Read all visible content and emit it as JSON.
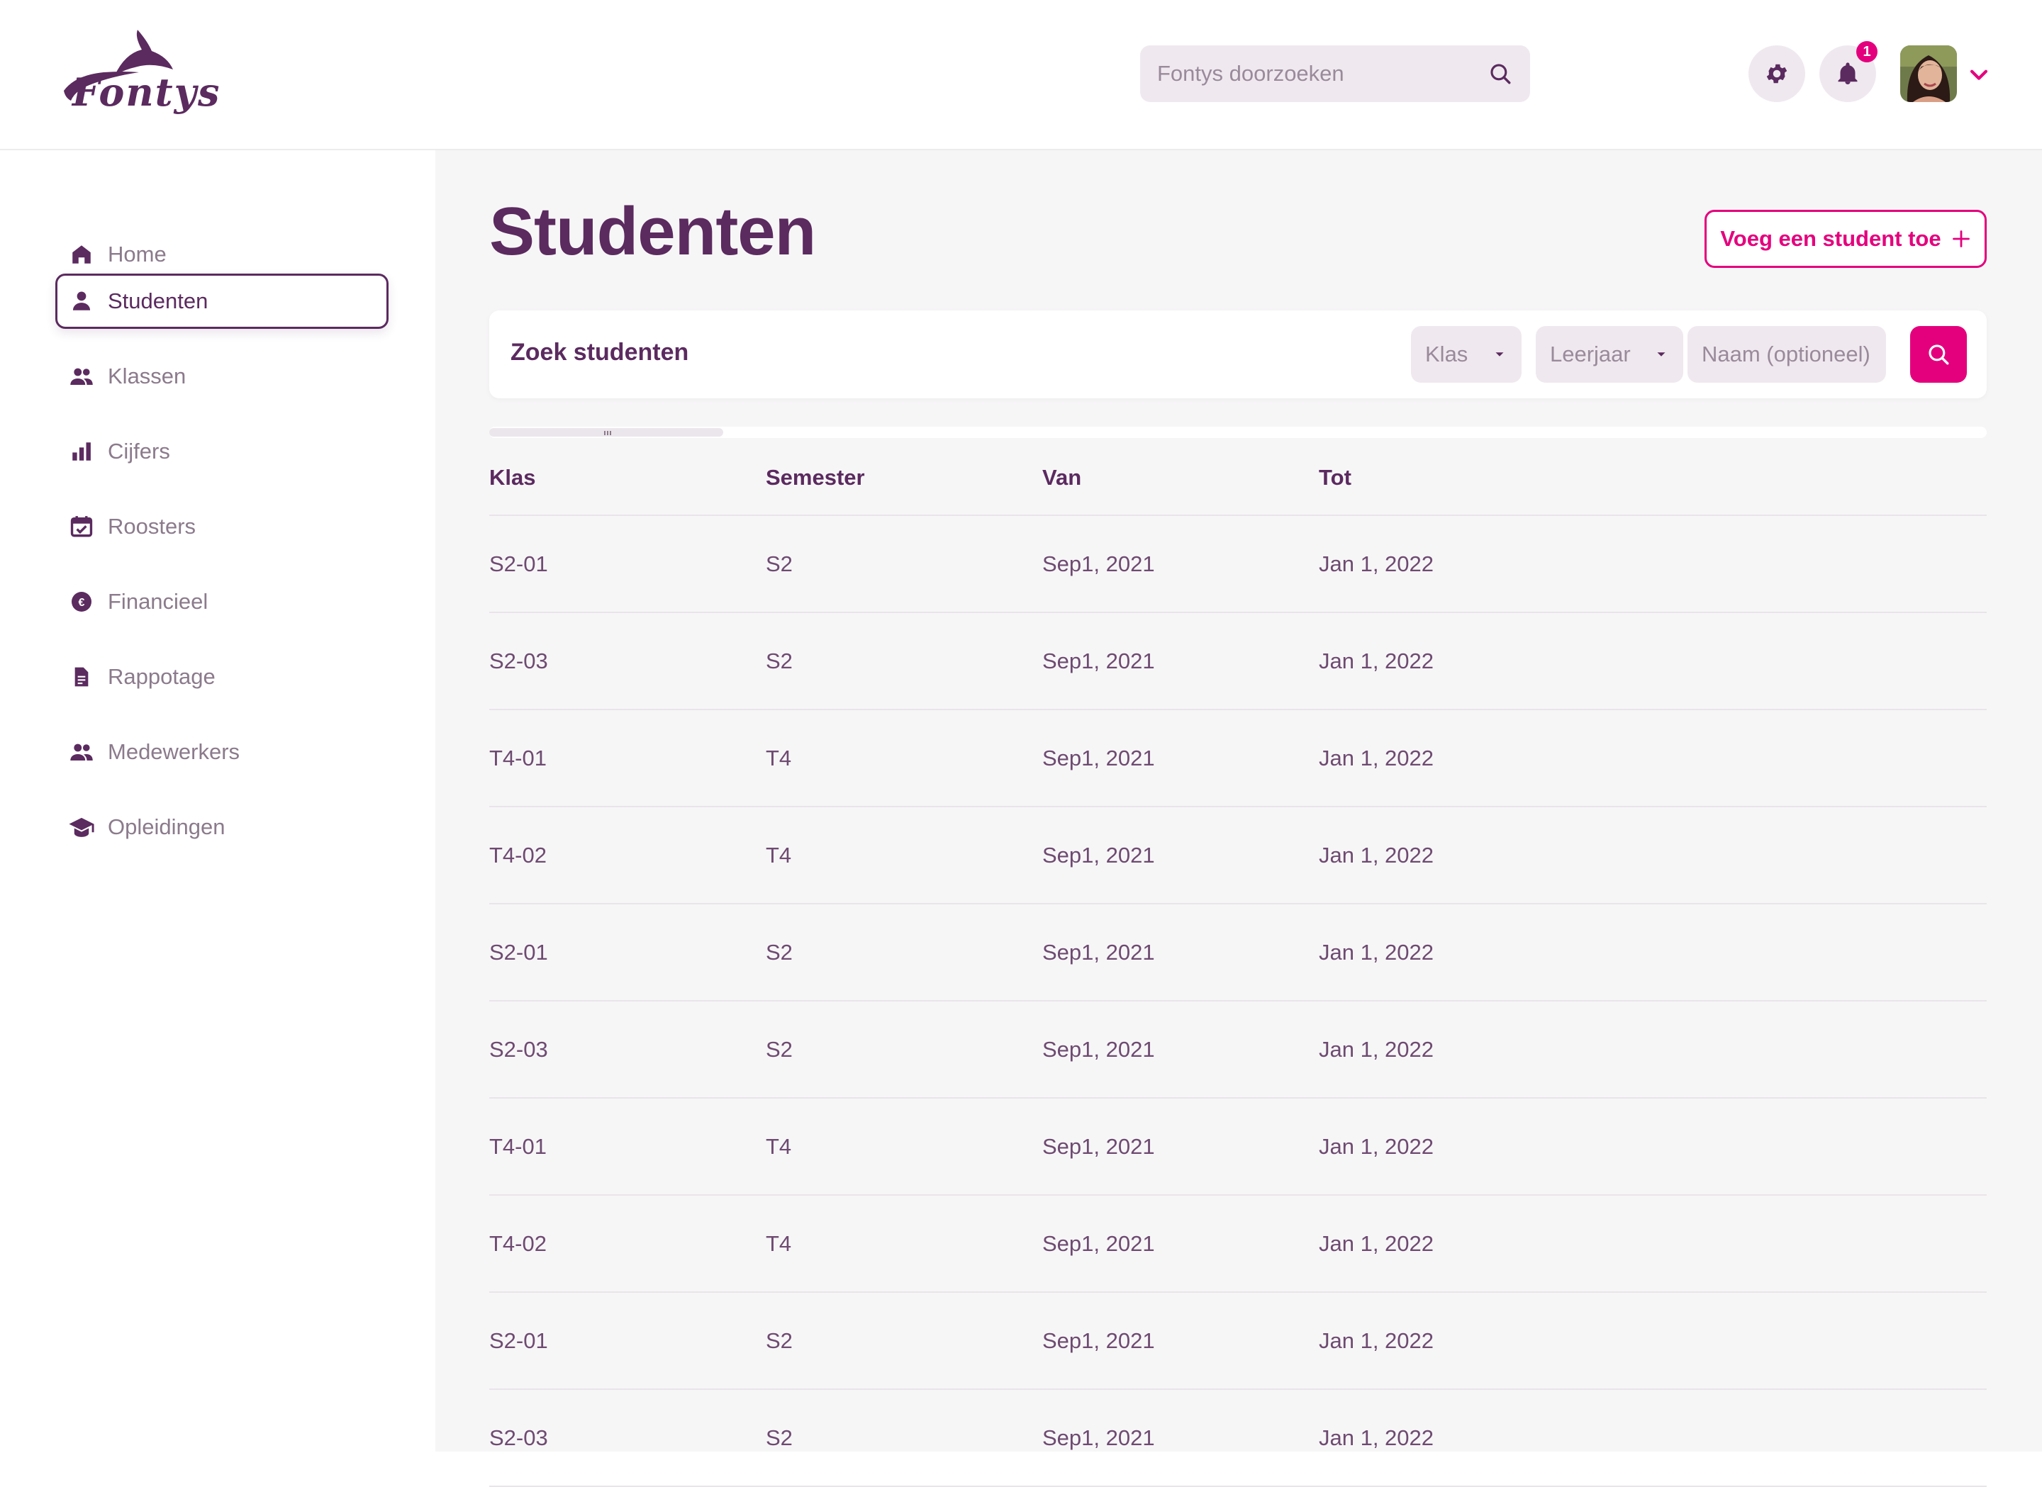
{
  "brand": {
    "logo_text": "Fontys",
    "primary_color": "#5b2a5f",
    "accent_color": "#e4007d"
  },
  "header": {
    "search_placeholder": "Fontys doorzoeken",
    "notification_count": "1",
    "icons": [
      "search-icon",
      "gear-icon",
      "bell-icon",
      "chevron-down-icon"
    ]
  },
  "sidebar": {
    "items": [
      {
        "label": "Home",
        "icon": "home-icon",
        "active": false
      },
      {
        "label": "Studenten",
        "icon": "person-icon",
        "active": true
      },
      {
        "label": "Klassen",
        "icon": "group-icon",
        "active": false
      },
      {
        "label": "Cijfers",
        "icon": "bar-chart-icon",
        "active": false
      },
      {
        "label": "Roosters",
        "icon": "calendar-check-icon",
        "active": false
      },
      {
        "label": "Financieel",
        "icon": "euro-icon",
        "active": false
      },
      {
        "label": "Rappotage",
        "icon": "document-icon",
        "active": false
      },
      {
        "label": "Medewerkers",
        "icon": "group-icon",
        "active": false
      },
      {
        "label": "Opleidingen",
        "icon": "graduation-cap-icon",
        "active": false
      }
    ]
  },
  "main": {
    "title": "Studenten",
    "add_button_label": "Voeg een student toe",
    "filter": {
      "label": "Zoek studenten",
      "klas_placeholder": "Klas",
      "leerjaar_placeholder": "Leerjaar",
      "naam_placeholder": "Naam (optioneel)"
    },
    "table": {
      "columns": [
        "Klas",
        "Semester",
        "Van",
        "Tot"
      ],
      "rows": [
        [
          "S2-01",
          "S2",
          "Sep1, 2021",
          "Jan 1, 2022"
        ],
        [
          "S2-03",
          "S2",
          "Sep1, 2021",
          "Jan 1, 2022"
        ],
        [
          "T4-01",
          "T4",
          "Sep1, 2021",
          "Jan 1, 2022"
        ],
        [
          "T4-02",
          "T4",
          "Sep1, 2021",
          "Jan 1, 2022"
        ],
        [
          "S2-01",
          "S2",
          "Sep1, 2021",
          "Jan 1, 2022"
        ],
        [
          "S2-03",
          "S2",
          "Sep1, 2021",
          "Jan 1, 2022"
        ],
        [
          "T4-01",
          "T4",
          "Sep1, 2021",
          "Jan 1, 2022"
        ],
        [
          "T4-02",
          "T4",
          "Sep1, 2021",
          "Jan 1, 2022"
        ],
        [
          "S2-01",
          "S2",
          "Sep1, 2021",
          "Jan 1, 2022"
        ],
        [
          "S2-03",
          "S2",
          "Sep1, 2021",
          "Jan 1, 2022"
        ]
      ]
    }
  }
}
